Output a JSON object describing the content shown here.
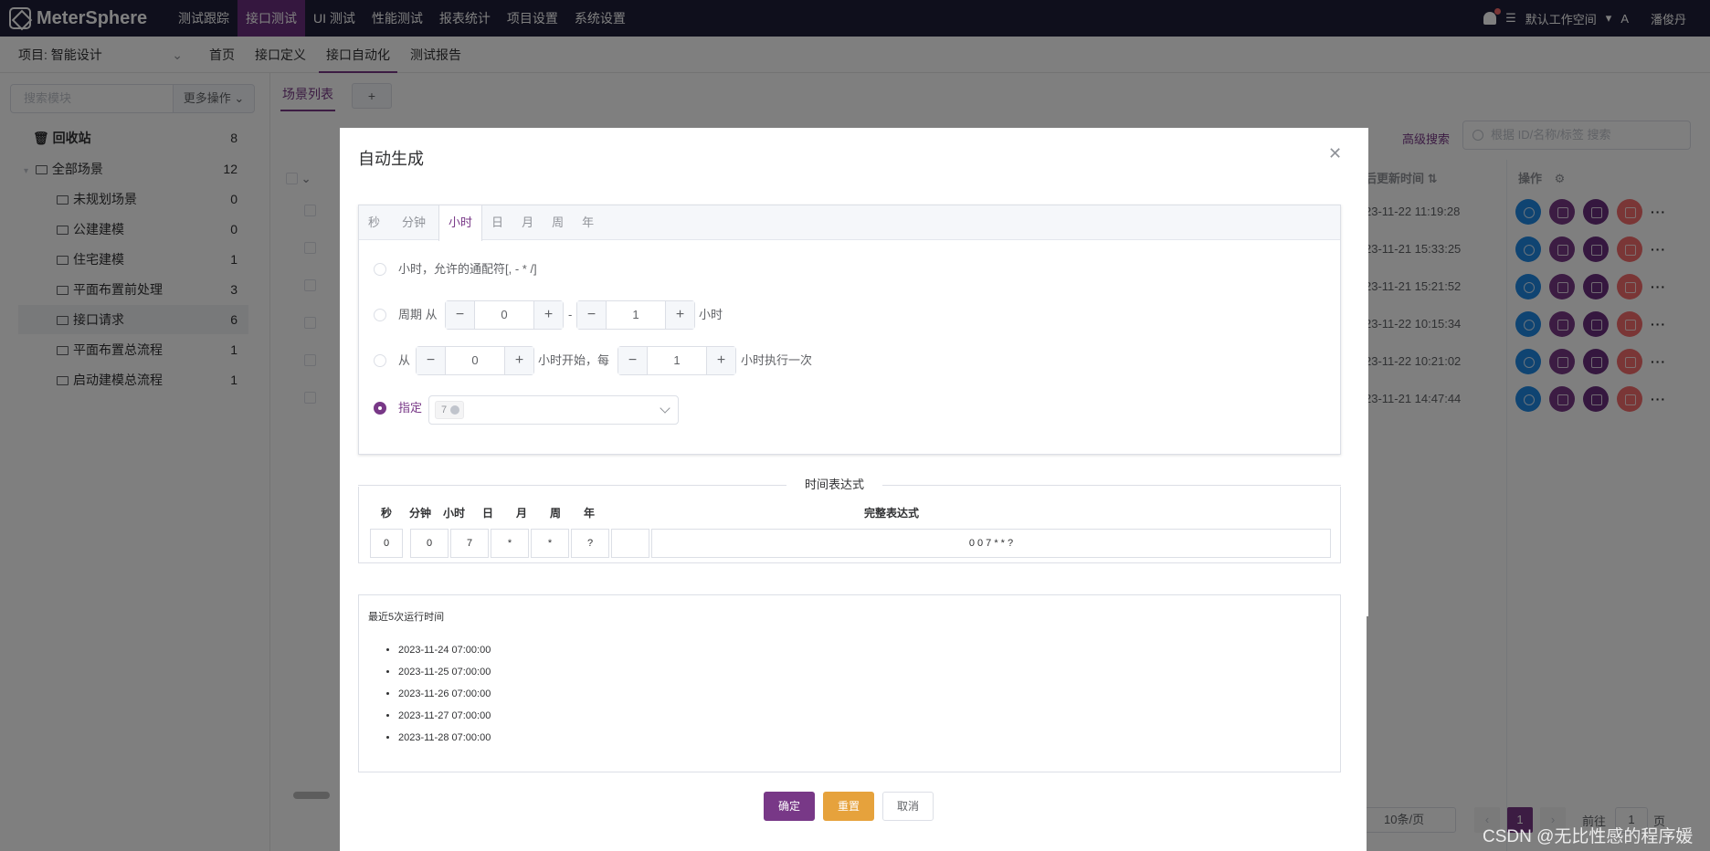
{
  "header": {
    "logo_text": "MeterSphere",
    "nav": [
      "测试跟踪",
      "接口测试",
      "UI 测试",
      "性能测试",
      "报表统计",
      "项目设置",
      "系统设置"
    ],
    "active_nav": "接口测试",
    "workspace": "默认工作空间",
    "lang_icon": "language-icon",
    "user": "潘俊丹"
  },
  "subheader": {
    "project": "项目: 智能设计",
    "nav": [
      "首页",
      "接口定义",
      "接口自动化",
      "测试报告"
    ]
  },
  "sidebar": {
    "search_placeholder": "搜索模块",
    "more_ops": "更多操作",
    "trash": {
      "label": "回收站",
      "count": "8"
    },
    "root": {
      "label": "全部场景",
      "count": "12"
    },
    "items": [
      {
        "label": "未规划场景",
        "count": "0"
      },
      {
        "label": "公建建模",
        "count": "0"
      },
      {
        "label": "住宅建模",
        "count": "1"
      },
      {
        "label": "平面布置前处理",
        "count": "3"
      },
      {
        "label": "接口请求",
        "count": "6"
      },
      {
        "label": "平面布置总流程",
        "count": "1"
      },
      {
        "label": "启动建模总流程",
        "count": "1"
      }
    ]
  },
  "main": {
    "tab": "场景列表",
    "tab_add": "+",
    "advanced_search": "高级搜索",
    "search_placeholder": "根据 ID/名称/标签 搜索",
    "col_updated": "后更新时间",
    "col_ops": "操作",
    "rows": [
      {
        "time": "23-11-22 11:19:28"
      },
      {
        "time": "23-11-21 15:33:25"
      },
      {
        "time": "23-11-21 15:21:52"
      },
      {
        "time": "23-11-22 10:15:34"
      },
      {
        "time": "23-11-22 10:21:02"
      },
      {
        "time": "23-11-21 14:47:44"
      }
    ],
    "page_size": "10条/页",
    "page_current": "1",
    "goto": "前往",
    "goto_page": "1",
    "page_suffix": "页"
  },
  "dialog": {
    "title": "自动生成",
    "tabs": [
      "秒",
      "分钟",
      "小时",
      "日",
      "月",
      "周",
      "年"
    ],
    "active_tab": "小时",
    "options": {
      "wildcard": "小时，允许的通配符[, - * /]",
      "cycle_prefix": "周期 从",
      "cycle_from": "0",
      "cycle_dash": "-",
      "cycle_to": "1",
      "cycle_suffix": "小时",
      "from_prefix": "从",
      "from_start": "0",
      "from_mid": "小时开始，每",
      "from_every": "1",
      "from_suffix": "小时执行一次",
      "specify": "指定",
      "specify_tag": "7"
    },
    "expr_divider": "时间表达式",
    "expr_headers": [
      "秒",
      "分钟",
      "小时",
      "日",
      "月",
      "周",
      "年",
      "完整表达式"
    ],
    "expr_values": [
      "0",
      "0",
      "7",
      "*",
      "*",
      "?",
      "",
      "0 0 7 * * ?"
    ],
    "recent_title": "最近5次运行时间",
    "recent": [
      "2023-11-24 07:00:00",
      "2023-11-25 07:00:00",
      "2023-11-26 07:00:00",
      "2023-11-27 07:00:00",
      "2023-11-28 07:00:00"
    ],
    "btn_ok": "确定",
    "btn_reset": "重置",
    "btn_cancel": "取消"
  },
  "watermark": "CSDN @无比性感的程序媛",
  "colors": {
    "brand": "#783887",
    "topbar": "#1f1f38",
    "warn": "#e6a23c",
    "danger": "#f56c6c",
    "run": "#1e88e5"
  }
}
